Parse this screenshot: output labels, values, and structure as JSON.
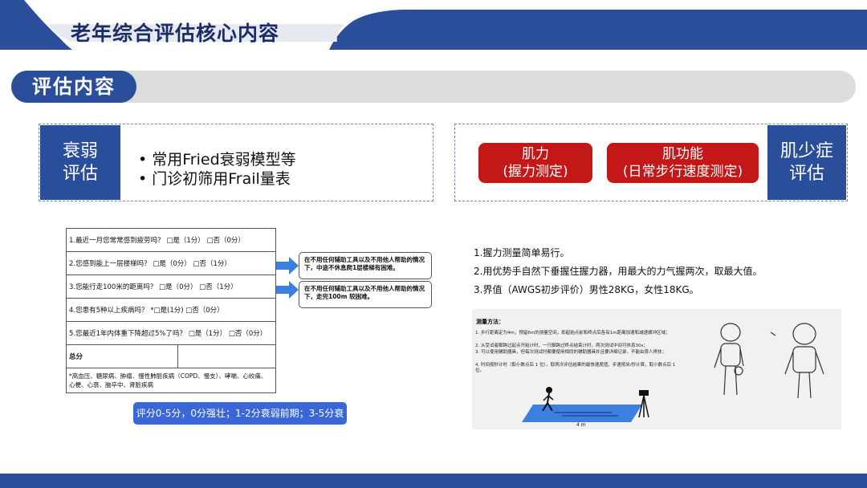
{
  "page": {
    "title": "老年综合评估核心内容",
    "section_label": "评估内容"
  },
  "frailty": {
    "label_line1": "衰弱",
    "label_line2": "评估",
    "bullets": [
      "•  常用Fried衰弱模型等",
      "•  门诊初筛用Frail量表"
    ]
  },
  "sarcopenia": {
    "label_line1": "肌少症",
    "label_line2": "评估",
    "btn_strength_title": "肌力",
    "btn_strength_sub": "(握力测定)",
    "btn_function_title": "肌功能",
    "btn_function_sub": "(日常步行速度测定)"
  },
  "frail_scale": {
    "q1": "1.最近一月您常常感到疲劳吗？ □是（1分）   □否（0分）",
    "q2": "2.您感到能上一层楼梯吗？ □是（0分）   □否（1分）",
    "q3": "3.您能行走100米的距离吗？ □是（0分）   □否（1分）",
    "q4": "4.您患有5种以上疾病吗？ *□是(1分)   □否（0分）",
    "q5": "5.您最近1年内体重下降超过5%了吗？ □是（1分）   □否（0分）",
    "total_label": "总分",
    "footnote": "*高血压、糖尿病、肿瘤、慢性肺脏疾病（COPD、慢支）、哮喘、心绞痛、心梗、心衰、脑卒中、肾脏疾病",
    "tip1": "在不用任何辅助工具以及不用他人帮助的情况下，中途不休息爬1层楼梯有困难。",
    "tip2": "在不用任何辅助工具以及不用他人帮助的情况下，走完100m 较困难。",
    "score_note": "评分0-5分，0分强壮；1-2分衰弱前期；3-5分衰弱"
  },
  "grip": {
    "line1": "1.握力测量简单易行。",
    "line2": "2.用优势手自然下垂握住握力器，用最大的力气握两次，取最大值。",
    "line3": "3.界值（AWGS初步评价）男性28KG，女性18KG。"
  },
  "walk_method": {
    "title": "测量方法：",
    "lines": [
      "1. 步行距离定为4m，预留6m的测量空间，即起始点前和终点后各有1m距离加速和减速缓冲区域；",
      "2. 从受试者脚跨过起点开始计时，一只脚跨过终点结束计时，两次测试中间可休息30s；",
      "3. 可以使用辅助器具，但每次测试时都要使用相同的辅助器具并且要详细记录，不能由旁人搀扶；",
      "4. 时间按秒计时（取小数点后 1 位），取两次评估结果的最快速度值，步速按米/秒计算，取小数点后 1 位。"
    ],
    "distance_label": "4 m"
  },
  "colors": {
    "navy": "#1b2c67",
    "blue": "#2a4e9a",
    "red": "#c41717",
    "arrow_blue": "#3b7fe0"
  }
}
